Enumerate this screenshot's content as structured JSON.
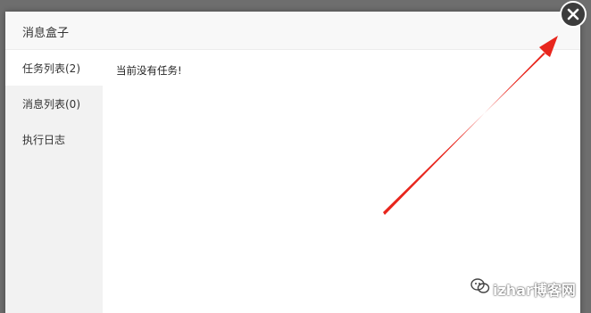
{
  "background": {
    "snippets": [
      "",
      "",
      ""
    ]
  },
  "dialog": {
    "title": "消息盒子",
    "close_icon": "close-icon",
    "tabs": [
      {
        "label": "任务列表(2)",
        "active": true
      },
      {
        "label": "消息列表(0)",
        "active": false
      },
      {
        "label": "执行日志",
        "active": false
      }
    ],
    "content": {
      "empty_text": "当前没有任务!"
    }
  },
  "annotation": {
    "type": "red-arrow",
    "color": "#e8261d",
    "points_to": "close-button"
  },
  "watermark": {
    "icon": "wechat-icon",
    "text": "izhar博客网"
  }
}
